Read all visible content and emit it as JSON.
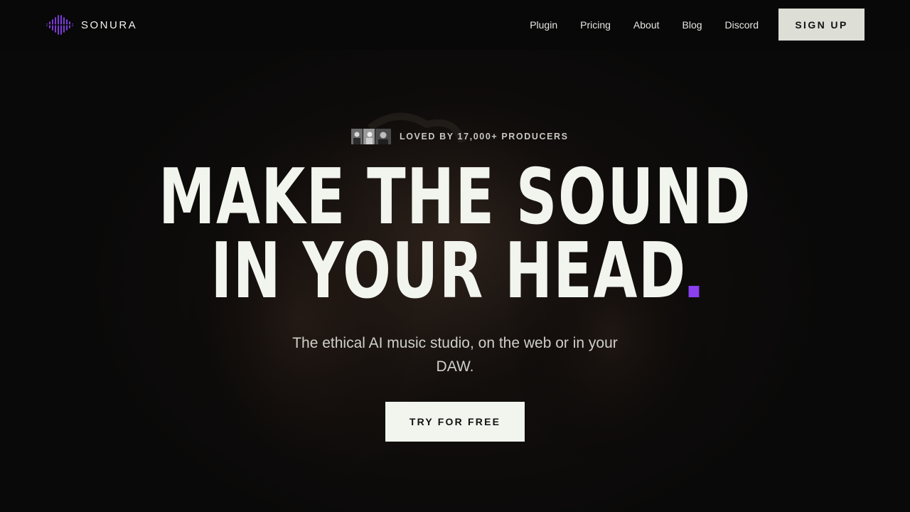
{
  "brand": {
    "name": "SONURA",
    "logo_icon": "waveform-diamond-icon",
    "accent": "#8a3ff0"
  },
  "nav": {
    "links": [
      "Plugin",
      "Pricing",
      "About",
      "Blog",
      "Discord"
    ],
    "signup_label": "SIGN UP"
  },
  "hero": {
    "social_proof": "LOVED BY 17,000+ PRODUCERS",
    "avatars": [
      "producer-avatar-icon",
      "producer-avatar-icon",
      "producer-avatar-icon"
    ],
    "headline_line1": "MAKE THE SOUND",
    "headline_line2": "IN YOUR HEAD",
    "subhead": "The ethical AI music studio, on the web or in your DAW.",
    "cta_label": "TRY FOR FREE",
    "background": "dim-portrait-photo"
  },
  "colors": {
    "background": "#0a0a0a",
    "text": "#f2f3ee",
    "button": "#dddfd7"
  }
}
